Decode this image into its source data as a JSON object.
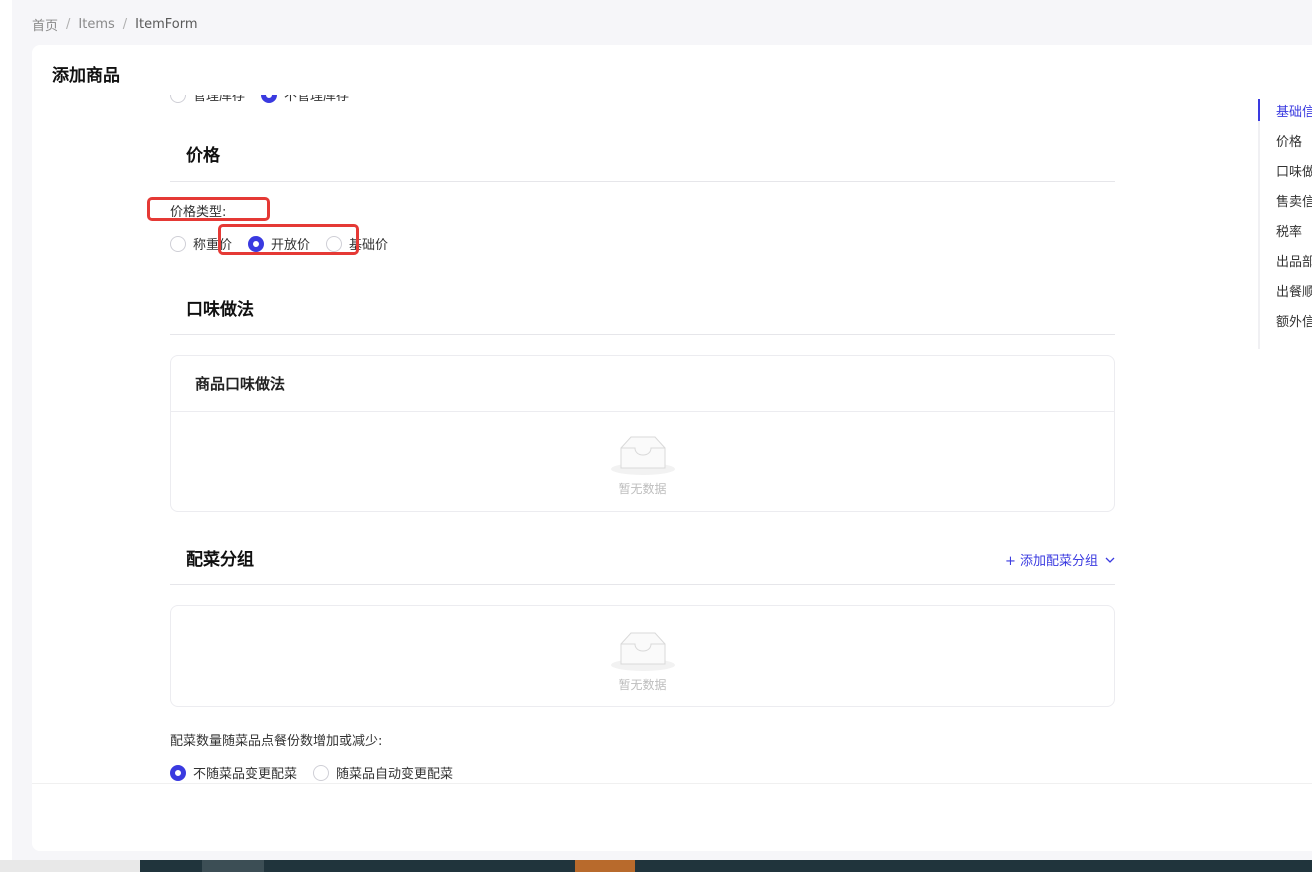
{
  "breadcrumb": {
    "home": "首页",
    "items": "Items",
    "current": "ItemForm",
    "sep": "/"
  },
  "page": {
    "title": "添加商品"
  },
  "inventory": {
    "options": [
      {
        "label": "管理库存",
        "checked": false
      },
      {
        "label": "不管理库存",
        "checked": true
      }
    ]
  },
  "price": {
    "section_title": "价格",
    "type_label": "价格类型:",
    "options": [
      {
        "label": "称重价",
        "checked": false
      },
      {
        "label": "开放价",
        "checked": true
      },
      {
        "label": "基础价",
        "checked": false
      }
    ]
  },
  "flavor": {
    "section_title": "口味做法",
    "box_title": "商品口味做法",
    "empty_text": "暂无数据"
  },
  "side_dish": {
    "section_title": "配菜分组",
    "add_label": "+ 添加配菜分组",
    "empty_text": "暂无数据",
    "qty_label": "配菜数量随菜品点餐份数增加或减少:",
    "options": [
      {
        "label": "不随菜品变更配菜",
        "checked": true
      },
      {
        "label": "随菜品自动变更配菜",
        "checked": false
      }
    ]
  },
  "anchor": {
    "items": [
      "基础信",
      "价格",
      "口味做",
      "售卖信",
      "税率",
      "出品部",
      "出餐顺",
      "额外信"
    ],
    "active": 0
  },
  "colors": {
    "accent": "#3a3ae0",
    "highlight": "#e53935"
  }
}
